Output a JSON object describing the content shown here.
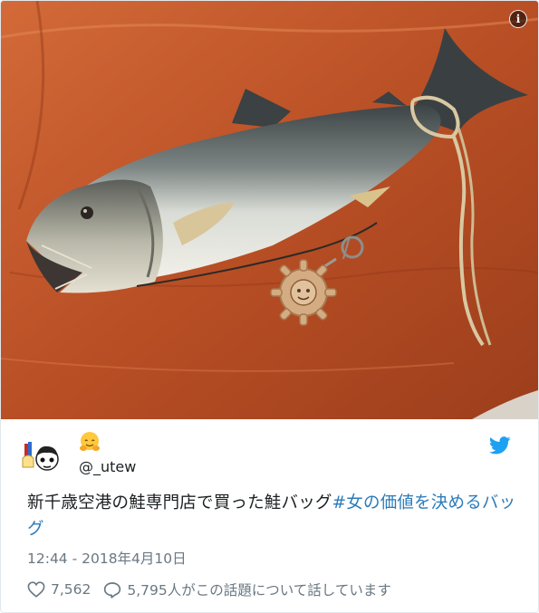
{
  "colors": {
    "twitter_blue": "#1da1f2",
    "hashtag": "#2b7bb9",
    "meta_gray": "#697882",
    "leather": "#c25a2e"
  },
  "media": {
    "info_glyph": "i",
    "info_icon": "info-icon"
  },
  "user": {
    "emoji_icon": "hugging-face-emoji-icon",
    "handle": "@_utew",
    "brand_icon": "twitter-bird-icon"
  },
  "tweet": {
    "text": "新千歳空港の鮭専門店で買った鮭バッグ",
    "hashtag": "#女の価値を決めるバッグ",
    "timestamp": "12:44 - 2018年4月10日"
  },
  "actions": {
    "like_icon": "heart-icon",
    "like_count": "7,562",
    "reply_icon": "speech-bubble-icon",
    "discussion_text": "5,795人がこの話題について話しています"
  }
}
